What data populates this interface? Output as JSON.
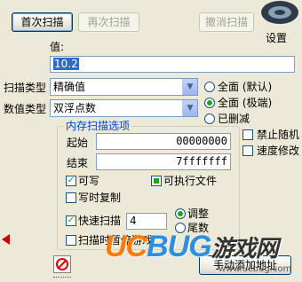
{
  "toolbar": {
    "first_scan": "首次扫描",
    "next_scan": "再次扫描",
    "undo_scan": "撤消扫描",
    "settings": "设置"
  },
  "value": {
    "label": "值:",
    "input": "10.2"
  },
  "scan_type": {
    "label": "扫描类型",
    "selected": "精确值"
  },
  "value_type": {
    "label": "数值类型",
    "selected": "双浮点数"
  },
  "memory_radios": {
    "all_default": "全面 (默认)",
    "all_extreme": "全面 (极端)",
    "deleted": "已删减"
  },
  "right_checks": {
    "disable_random": "禁止随机",
    "speed_mod": "速度修改"
  },
  "memory_options": {
    "title": "内存扫描选项",
    "start_label": "起始",
    "start_value": "00000000",
    "end_label": "结束",
    "end_value": "7fffffff",
    "writable": "可写",
    "executable": "可执行文件",
    "copy_on_write": "写时复制",
    "fast_scan": "快速扫描",
    "fast_scan_value": "4",
    "align_label": "调整",
    "last_digits_label": "尾数",
    "pause_label": "扫描时暂停游戏"
  },
  "add_address_button": "手动添加地址",
  "watermark": "UCBUG游戏网",
  "watermark_url": "www.ucbug.com",
  "colors": {
    "accent": "#0046d5",
    "check_green": "#21a121",
    "border_blue": "#003c74",
    "selection": "#316ac5"
  }
}
